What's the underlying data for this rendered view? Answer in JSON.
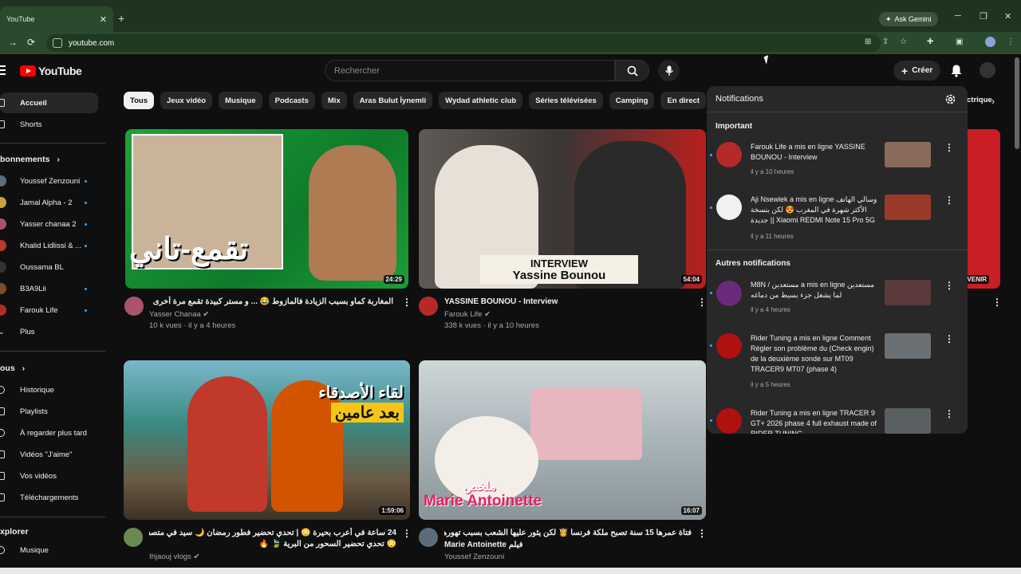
{
  "browser": {
    "tab_title": "YouTube",
    "tab_close": "✕",
    "new_tab": "+",
    "url": "youtube.com",
    "gemini_label": "Ask Gemini",
    "win_min": "─",
    "win_max": "❐",
    "win_close": "✕"
  },
  "header": {
    "logo_text": "YouTube",
    "search_placeholder": "Rechercher",
    "create_label": "Créer"
  },
  "sidebar": {
    "main": [
      {
        "label": "Accueil"
      },
      {
        "label": "Shorts"
      }
    ],
    "subs_heading": "bonnements",
    "subs": [
      {
        "label": "Youssef Zenzouni"
      },
      {
        "label": "Jamal Alpha - 2"
      },
      {
        "label": "Yasser chanaa 2"
      },
      {
        "label": "Khalid Lidlissi & ..."
      },
      {
        "label": "Oussama BL"
      },
      {
        "label": "B3A9Lii"
      },
      {
        "label": "Farouk Life"
      },
      {
        "label": "Plus"
      }
    ],
    "you_heading": "ous",
    "you": [
      {
        "label": "Historique"
      },
      {
        "label": "Playlists"
      },
      {
        "label": "À regarder plus tard"
      },
      {
        "label": "Vidéos \"J'aime\""
      },
      {
        "label": "Vos vidéos"
      },
      {
        "label": "Téléchargements"
      }
    ],
    "explore_heading": "xplorer",
    "explore": [
      {
        "label": "Musique"
      }
    ]
  },
  "chips": [
    "Tous",
    "Jeux vidéo",
    "Musique",
    "Podcasts",
    "Mix",
    "Aras Bulut İynemli",
    "Wydad athletic club",
    "Séries télévisées",
    "Camping",
    "En direct",
    "Te"
  ],
  "chip_right": "ctrique",
  "videos": [
    {
      "title": "المغاربة كماو بسبب الزيادة فالمازوط 😂 ... و مستر كبيدة تقمع مرة أخرى",
      "channel": "Yasser Chanaa",
      "meta": "10 k vues · il y a 4 heures",
      "duration": "24:29",
      "overlay": "تقمع-تاني"
    },
    {
      "title": "YASSINE BOUNOU - Interview",
      "channel": "Farouk Life",
      "meta": "338 k vues · il y a 10 heures",
      "duration": "54:04",
      "overlay_top": "INTERVIEW",
      "overlay_bottom": "Yassine Bounou"
    },
    {
      "title": "24 ساعة في أعرب بحيرة 😳 | تحدي تحضير فطور رمضان 🌙 سيد في متصف الليل",
      "title2": "😳 تحدي تحضير السحور من البرية 🍃 🔥",
      "channel": "Ihjaouj vlogs",
      "meta": "",
      "duration": "1:59:06",
      "overlay_top": "لقاء الأصدقاء",
      "overlay_bottom": "بعد عامين"
    },
    {
      "title": "فتاة عمرها 15 سنة تصبح ملكة فرنسا 👸 لكن يثور عليها الشعب بسبب تهورها 😱 | ملخص",
      "title2": "Marie Antoinette فيلم",
      "channel": "Youssef Zenzouni",
      "meta": "",
      "duration": "16:07",
      "overlay_top": "ملخص",
      "overlay_bottom": "Marie Antoinette"
    }
  ],
  "partial_badge": "À VENIR",
  "notifications": {
    "title": "Notifications",
    "important_heading": "Important",
    "other_heading": "Autres notifications",
    "items": [
      {
        "text": "Farouk Life a mis en ligne YASSINE BOUNOU - Interview",
        "time": "il y a 10 heures"
      },
      {
        "text": "Aji Nsewlek a mis en ligne وسالي الهاتف الأكثر شهرة في المغرب 😍 لكن بنسخة جديدة || Xiaomi REDMI Note 15 Pro 5G",
        "time": "il y a 11 heures"
      },
      {
        "text": "M8N / مستعدين a mis en ligne مستعدين لما يشغل جزء بسيط من دماغه",
        "time": "il y a 4 heures"
      },
      {
        "text": "Rider Tuning a mis en ligne Comment Régler son problème du (Check engin) de la deuxième sonde sur MT09 TRACER9 MT07 (phase 4)",
        "time": "il y a 5 heures"
      },
      {
        "text": "Rider Tuning a mis en ligne TRACER 9 GT+ 2026 phase 4 full exhaust made of RIDER TUNING",
        "time": ""
      }
    ]
  },
  "colors": {
    "brand": "#ff0000",
    "accent": "#3ea6ff",
    "browser_frame": "#1f3320"
  }
}
